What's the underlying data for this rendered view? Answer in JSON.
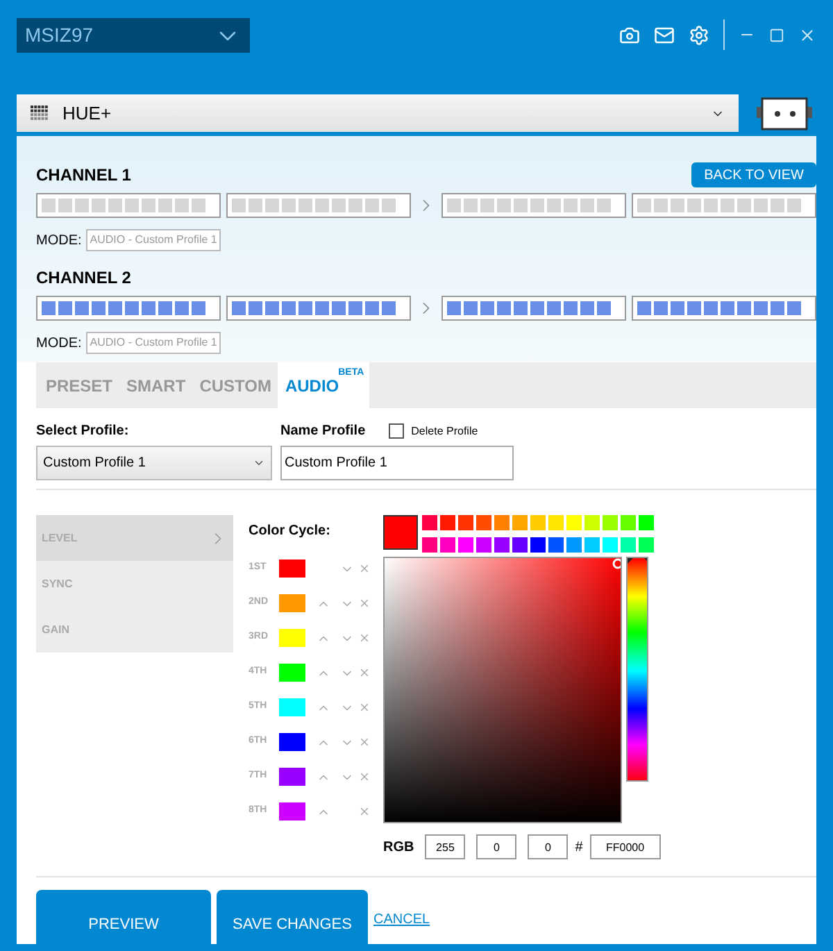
{
  "device_select": {
    "value": "MSIZ97"
  },
  "product_select": {
    "value": "HUE+"
  },
  "back_button": "BACK TO VIEW",
  "channels": [
    {
      "title": "CHANNEL 1",
      "lit": false,
      "mode_label": "MODE:",
      "mode_value": "AUDIO - Custom Profile 1"
    },
    {
      "title": "CHANNEL 2",
      "lit": true,
      "mode_label": "MODE:",
      "mode_value": "AUDIO - Custom Profile 1"
    }
  ],
  "tabs": [
    {
      "label": "PRESET",
      "selected": false
    },
    {
      "label": "SMART",
      "selected": false
    },
    {
      "label": "CUSTOM",
      "selected": false
    },
    {
      "label": "AUDIO",
      "badge": "BETA",
      "selected": true
    }
  ],
  "select_profile": {
    "label": "Select Profile:",
    "value": "Custom Profile 1"
  },
  "name_profile": {
    "label": "Name Profile",
    "value": "Custom Profile 1"
  },
  "delete_profile": {
    "label": "Delete Profile",
    "checked": false
  },
  "side_menu": [
    {
      "label": "LEVEL",
      "selected": true
    },
    {
      "label": "SYNC",
      "selected": false
    },
    {
      "label": "GAIN",
      "selected": false
    }
  ],
  "color_cycle": {
    "label": "Color Cycle:",
    "rows": [
      {
        "ordinal": "1ST",
        "color": "#ff0000",
        "can_move_up": false,
        "can_move_down": true
      },
      {
        "ordinal": "2ND",
        "color": "#ff9900",
        "can_move_up": true,
        "can_move_down": true
      },
      {
        "ordinal": "3RD",
        "color": "#ffff00",
        "can_move_up": true,
        "can_move_down": true
      },
      {
        "ordinal": "4TH",
        "color": "#00ff00",
        "can_move_up": true,
        "can_move_down": true
      },
      {
        "ordinal": "5TH",
        "color": "#00ffff",
        "can_move_up": true,
        "can_move_down": true
      },
      {
        "ordinal": "6TH",
        "color": "#0000ff",
        "can_move_up": true,
        "can_move_down": true
      },
      {
        "ordinal": "7TH",
        "color": "#9900ff",
        "can_move_up": true,
        "can_move_down": true
      },
      {
        "ordinal": "8TH",
        "color": "#cc00ff",
        "can_move_up": true,
        "can_move_down": false
      }
    ]
  },
  "picker": {
    "hue_slider": {
      "level": 0
    },
    "swatches": [
      {
        "color": "#ff0044"
      },
      {
        "color": "#ff1a00"
      },
      {
        "color": "#ff3300"
      },
      {
        "color": "#ff4d00"
      },
      {
        "color": "#ff8000"
      },
      {
        "color": "#ffa500"
      },
      {
        "color": "#ffcc00"
      },
      {
        "color": "#ffe500"
      },
      {
        "color": "#ffff00"
      },
      {
        "color": "#ccff00"
      },
      {
        "color": "#99ff00"
      },
      {
        "color": "#66ff00"
      },
      {
        "color": "#00ff00"
      },
      {
        "color": "#ff0080"
      },
      {
        "color": "#ff00c0"
      },
      {
        "color": "#ff00ff"
      },
      {
        "color": "#cc00ff"
      },
      {
        "color": "#9900ff"
      },
      {
        "color": "#6600ff"
      },
      {
        "color": "#0000ff"
      },
      {
        "color": "#0055ff"
      },
      {
        "color": "#0099ff"
      },
      {
        "color": "#00ccff"
      },
      {
        "color": "#00ffff"
      },
      {
        "color": "#00ffaa"
      },
      {
        "color": "#00ff55"
      }
    ],
    "rgb_label": "RGB",
    "r": "255",
    "g": "0",
    "b": "0",
    "hash_label": "#",
    "hex": "FF0000"
  },
  "buttons": {
    "preview": "PREVIEW",
    "save": "SAVE CHANGES",
    "cancel": "CANCEL"
  }
}
